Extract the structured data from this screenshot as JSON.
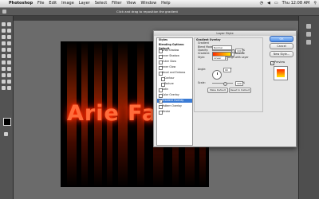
{
  "menubar": {
    "app_name": "Photoshop",
    "items": [
      "File",
      "Edit",
      "Image",
      "Layer",
      "Select",
      "Filter",
      "View",
      "Window",
      "Help"
    ],
    "clock": "Thu 12:08 AM"
  },
  "options_bar": {
    "hint": "Click and drag to reposition the gradient"
  },
  "canvas": {
    "text": "Arie Fa"
  },
  "dialog": {
    "title": "Layer Style",
    "styles_header": "Styles",
    "styles": [
      {
        "label": "Blending Options: Default",
        "checked": null,
        "selected": false
      },
      {
        "label": "Drop Shadow",
        "checked": false,
        "selected": false
      },
      {
        "label": "Inner Shadow",
        "checked": false,
        "selected": false
      },
      {
        "label": "Outer Glow",
        "checked": false,
        "selected": false
      },
      {
        "label": "Inner Glow",
        "checked": false,
        "selected": false
      },
      {
        "label": "Bevel and Emboss",
        "checked": false,
        "selected": false
      },
      {
        "label": "Contour",
        "checked": false,
        "selected": false
      },
      {
        "label": "Texture",
        "checked": false,
        "selected": false
      },
      {
        "label": "Satin",
        "checked": false,
        "selected": false
      },
      {
        "label": "Color Overlay",
        "checked": false,
        "selected": false
      },
      {
        "label": "Gradient Overlay",
        "checked": true,
        "selected": true
      },
      {
        "label": "Pattern Overlay",
        "checked": false,
        "selected": false
      },
      {
        "label": "Stroke",
        "checked": false,
        "selected": false
      }
    ],
    "panel": {
      "title": "Gradient Overlay",
      "section": "Gradient",
      "blend_mode_label": "Blend Mode:",
      "blend_mode_value": "Normal",
      "opacity_label": "Opacity:",
      "opacity_value": "100",
      "opacity_unit": "%",
      "gradient_label": "Gradient:",
      "reverse_label": "Reverse",
      "style_label": "Style:",
      "style_value": "Linear",
      "align_label": "Align with Layer",
      "angle_label": "Angle:",
      "angle_value": "90",
      "angle_unit": "°",
      "scale_label": "Scale:",
      "scale_value": "100",
      "scale_unit": "%",
      "make_default": "Make Default",
      "reset_default": "Reset to Default"
    },
    "buttons": {
      "ok": "OK",
      "cancel": "Cancel",
      "new_style": "New Style...",
      "preview": "Preview"
    },
    "gradient_colors": [
      "#ff2a00",
      "#ffe600"
    ]
  }
}
